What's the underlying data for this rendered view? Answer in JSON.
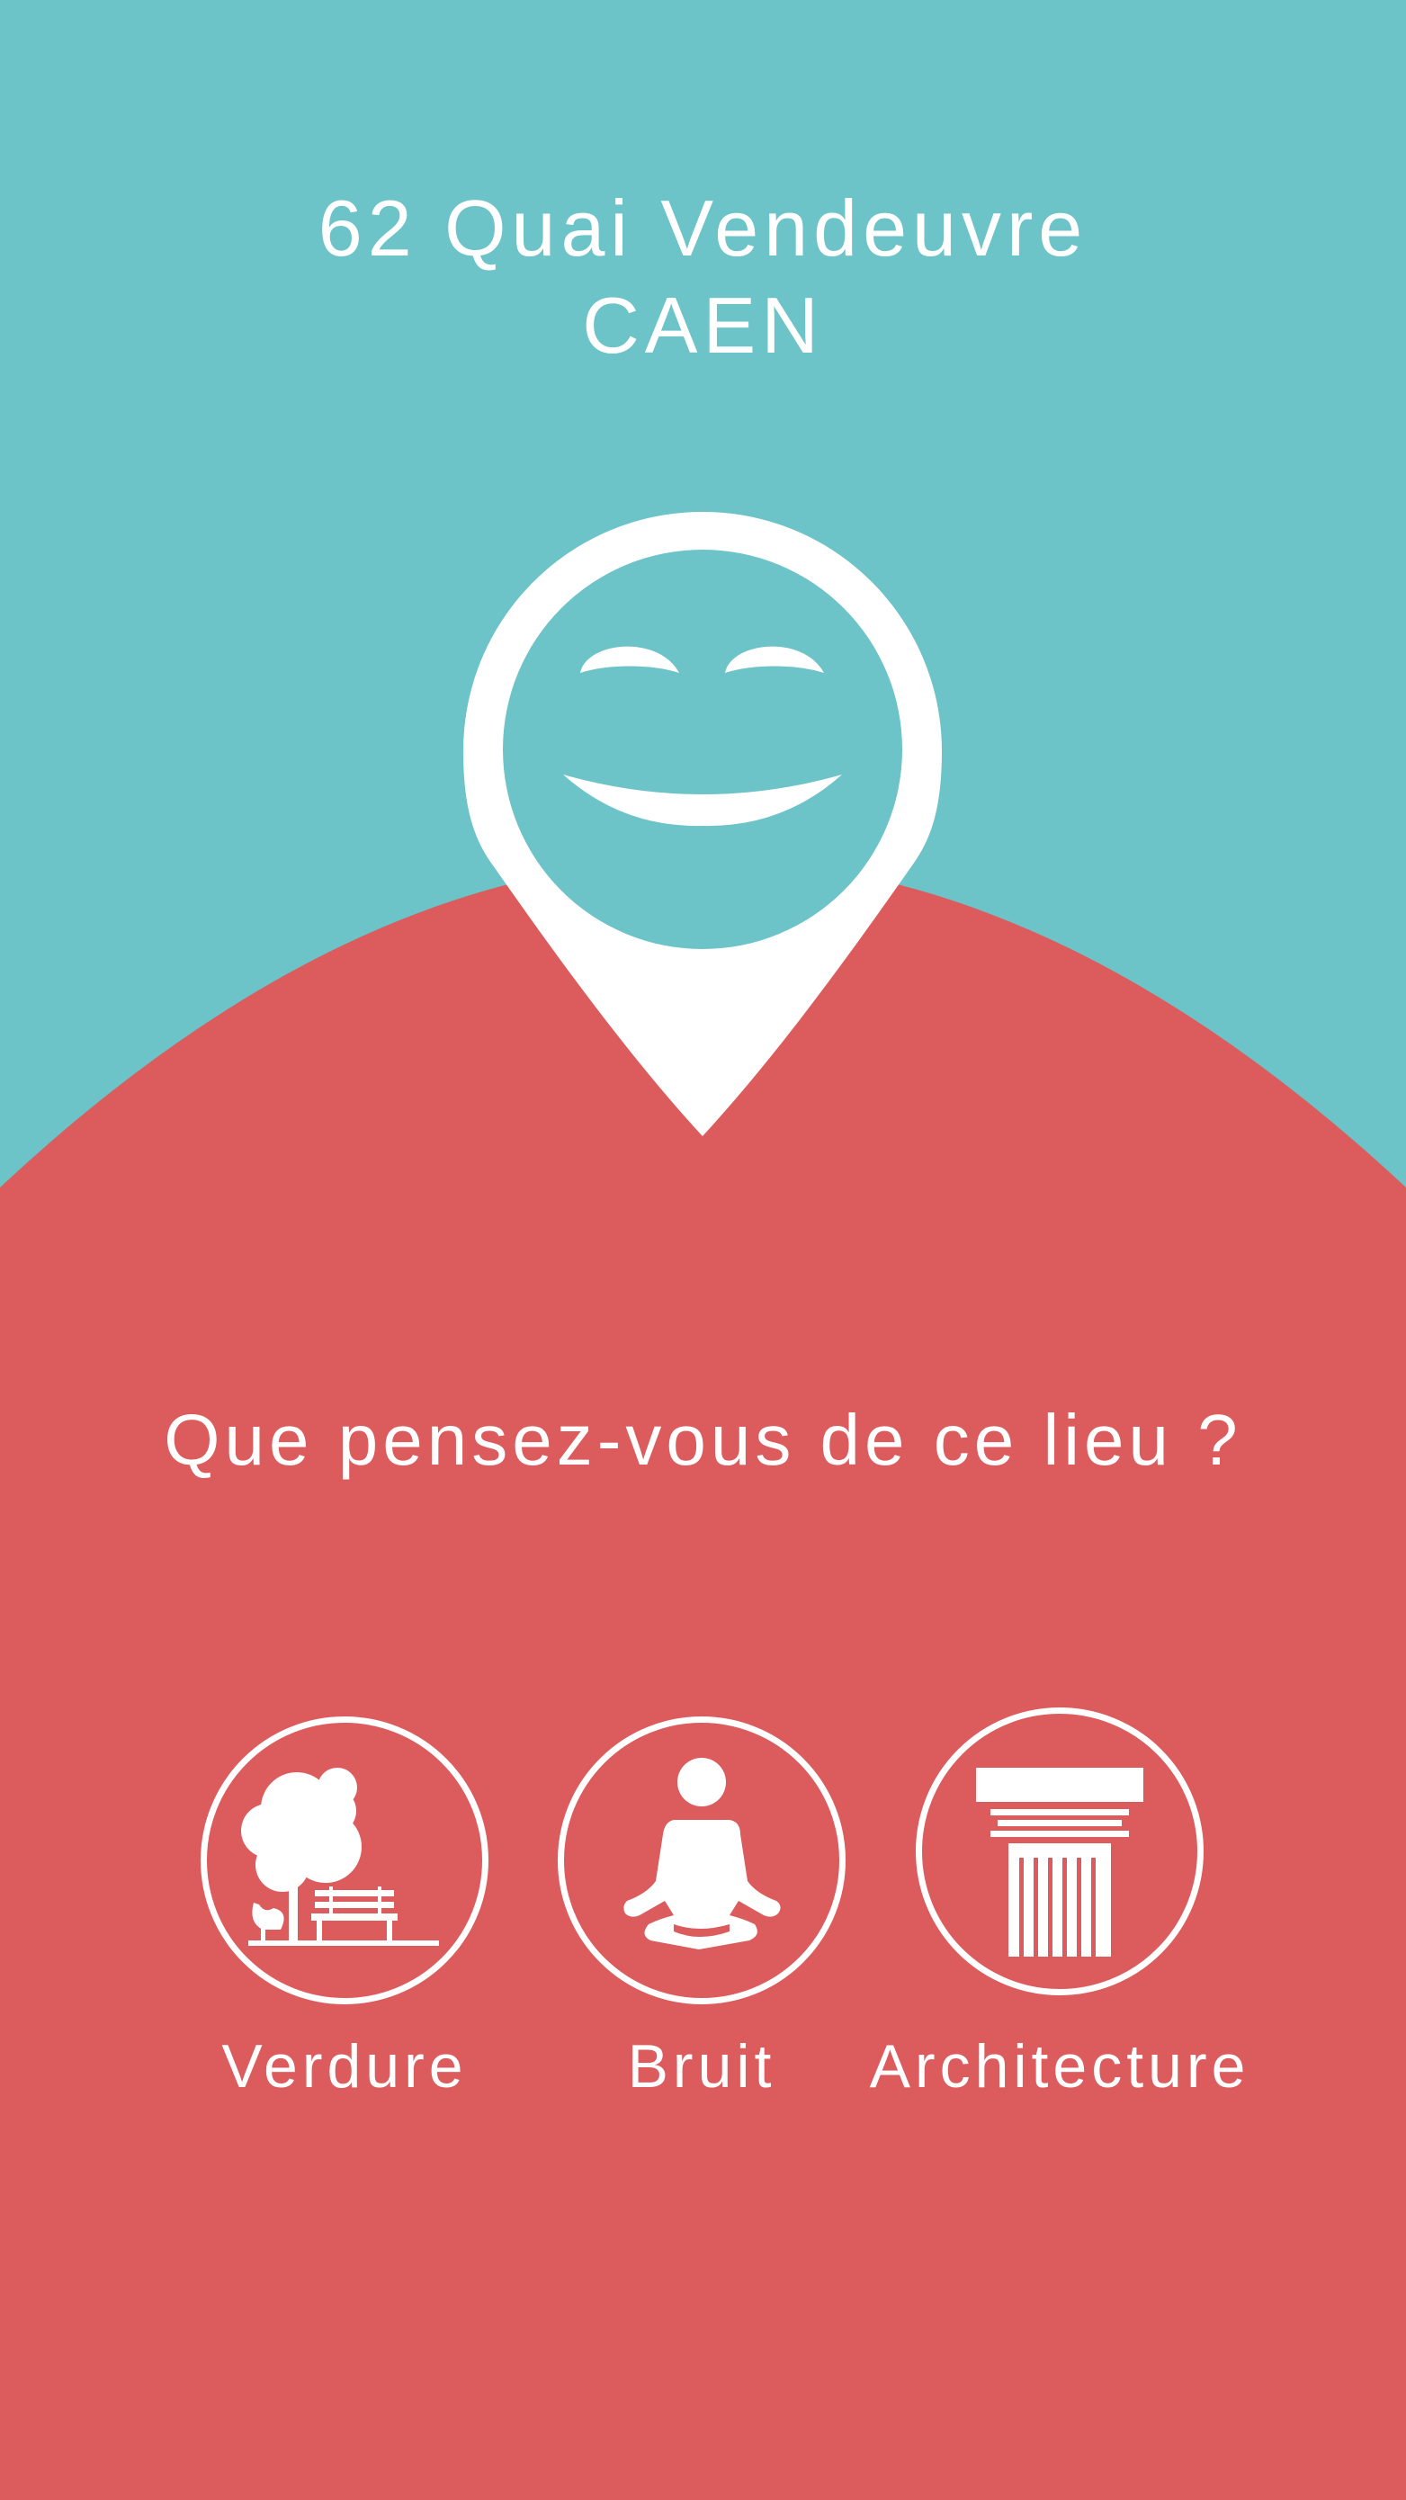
{
  "location": {
    "street": "62 Quai Vendeuvre",
    "city": "CAEN"
  },
  "question": "Que pensez-vous de ce lieu ?",
  "categories": [
    {
      "label": "Verdure",
      "icon": "park-tree-bench-icon"
    },
    {
      "label": "Bruit",
      "icon": "meditation-person-icon"
    },
    {
      "label": "Architecture",
      "icon": "greek-column-icon"
    }
  ],
  "pin_icon": "smiley-map-pin-icon",
  "colors": {
    "top_background": "#6cc3c8",
    "bottom_background": "#dc5b5c",
    "foreground": "#ffffff"
  }
}
